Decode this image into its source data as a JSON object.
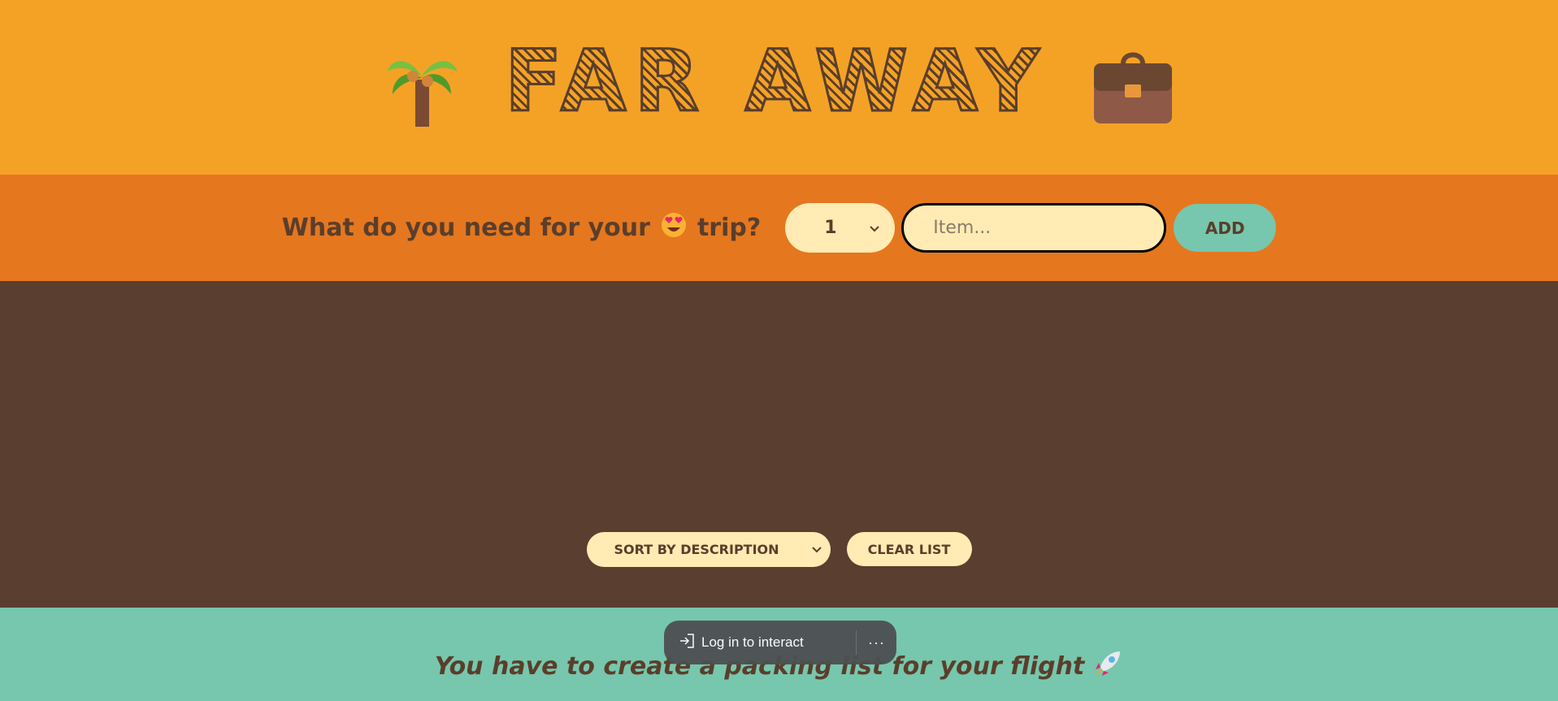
{
  "header": {
    "title": "FAR AWAY",
    "left_icon": "palm-tree-icon",
    "right_icon": "briefcase-icon"
  },
  "form": {
    "question_before": "What do you need for your",
    "question_emoji": "heart-eyes-face-icon",
    "question_after": "trip?",
    "quantity_value": "1",
    "item_placeholder": "Item...",
    "add_label": "ADD"
  },
  "actions": {
    "sort_value": "SORT BY DESCRIPTION",
    "clear_label": "CLEAR LIST"
  },
  "footer": {
    "text": "You have to create a packing list for your flight",
    "emoji": "rocket-icon"
  },
  "overlay": {
    "login_label": "Log in to interact",
    "more_label": "···"
  },
  "colors": {
    "header_bg": "#f4a226",
    "form_bg": "#e5771f",
    "list_bg": "#5a3e2f",
    "footer_bg": "#76c7ad",
    "cream": "#ffebb3",
    "text_brown": "#5a3e2b"
  }
}
